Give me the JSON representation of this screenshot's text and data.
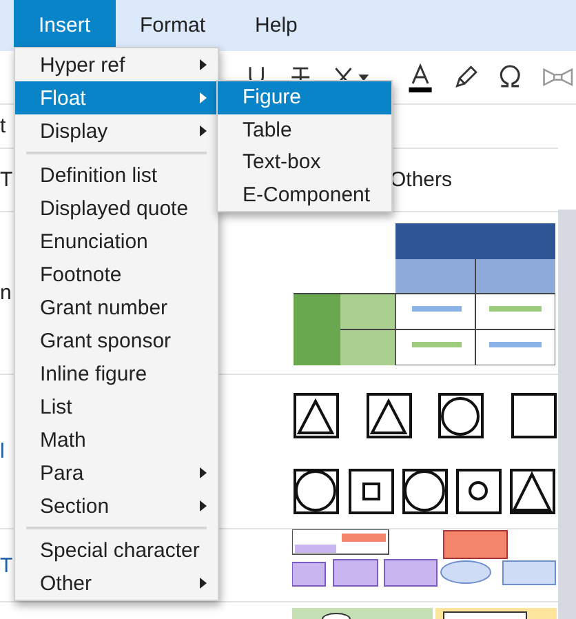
{
  "menubar": [
    {
      "label": "Insert",
      "selected": true
    },
    {
      "label": "Format",
      "selected": false
    },
    {
      "label": "Help",
      "selected": false
    }
  ],
  "insert_menu": [
    {
      "kind": "item",
      "label": "Hyper ref",
      "has_submenu": true,
      "selected": false
    },
    {
      "kind": "item",
      "label": "Float",
      "has_submenu": true,
      "selected": true
    },
    {
      "kind": "item",
      "label": "Display",
      "has_submenu": true,
      "selected": false
    },
    {
      "kind": "separator"
    },
    {
      "kind": "item",
      "label": "Definition list",
      "has_submenu": false,
      "selected": false
    },
    {
      "kind": "item",
      "label": "Displayed quote",
      "has_submenu": false,
      "selected": false
    },
    {
      "kind": "item",
      "label": "Enunciation",
      "has_submenu": false,
      "selected": false
    },
    {
      "kind": "item",
      "label": "Footnote",
      "has_submenu": false,
      "selected": false
    },
    {
      "kind": "item",
      "label": "Grant number",
      "has_submenu": false,
      "selected": false
    },
    {
      "kind": "item",
      "label": "Grant sponsor",
      "has_submenu": false,
      "selected": false
    },
    {
      "kind": "item",
      "label": "Inline figure",
      "has_submenu": false,
      "selected": false
    },
    {
      "kind": "item",
      "label": "List",
      "has_submenu": false,
      "selected": false
    },
    {
      "kind": "item",
      "label": "Math",
      "has_submenu": false,
      "selected": false
    },
    {
      "kind": "item",
      "label": "Para",
      "has_submenu": true,
      "selected": false
    },
    {
      "kind": "item",
      "label": "Section",
      "has_submenu": true,
      "selected": false
    },
    {
      "kind": "separator"
    },
    {
      "kind": "item",
      "label": "Special character",
      "has_submenu": false,
      "selected": false
    },
    {
      "kind": "item",
      "label": "Other",
      "has_submenu": true,
      "selected": false
    }
  ],
  "float_submenu": [
    {
      "label": "Figure",
      "selected": true
    },
    {
      "label": "Table",
      "selected": false
    },
    {
      "label": "Text-box",
      "selected": false
    },
    {
      "label": "E-Component",
      "selected": false
    }
  ],
  "document_rows": [
    {
      "kind": "text",
      "left_text": "t"
    },
    {
      "kind": "text",
      "left_text": "T",
      "right_text": "Others"
    },
    {
      "kind": "picture",
      "left_text": "n"
    },
    {
      "kind": "picture",
      "left_text": "l"
    },
    {
      "kind": "picture",
      "left_text": "T"
    },
    {
      "kind": "picture"
    }
  ]
}
